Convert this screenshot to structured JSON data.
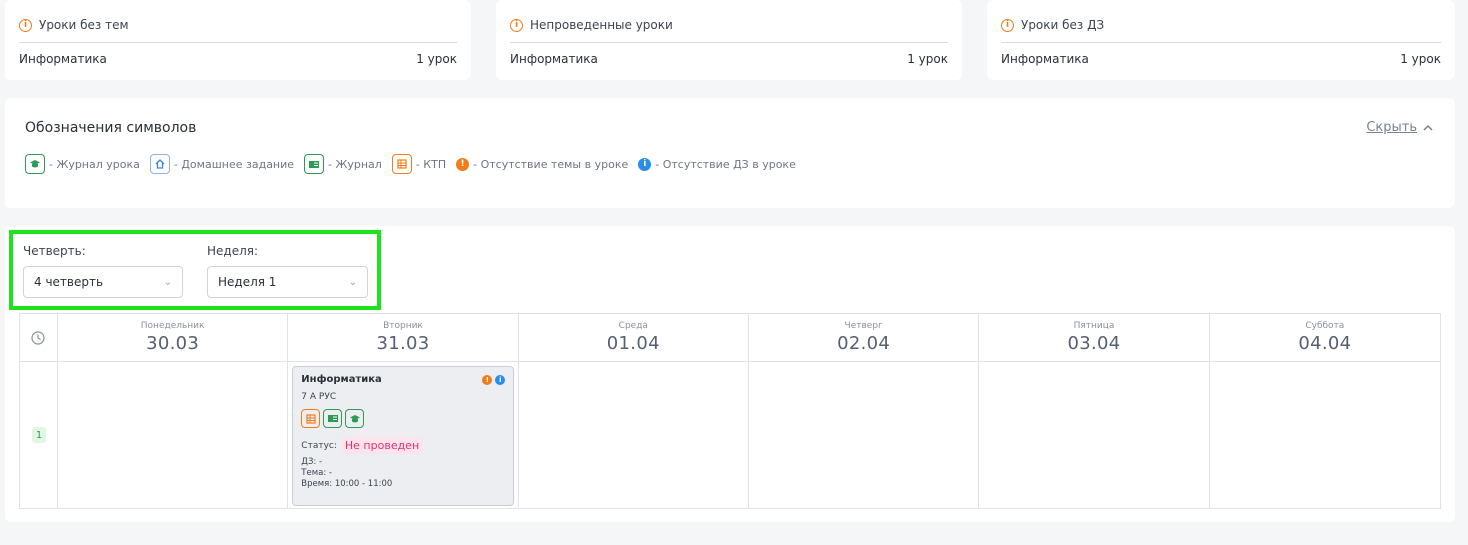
{
  "summary_cards": [
    {
      "title": "Уроки без тем",
      "subject": "Информатика",
      "count": "1 урок"
    },
    {
      "title": "Непроведенные уроки",
      "subject": "Информатика",
      "count": "1 урок"
    },
    {
      "title": "Уроки без ДЗ",
      "subject": "Информатика",
      "count": "1 урок"
    }
  ],
  "legend": {
    "title": "Обозначения символов",
    "hide_label": "Скрыть",
    "items": [
      {
        "icon": "graduation-cap-icon",
        "label": "- Журнал урока"
      },
      {
        "icon": "house-icon",
        "label": "- Домашнее задание"
      },
      {
        "icon": "journal-book-icon",
        "label": "- Журнал"
      },
      {
        "icon": "ktp-table-icon",
        "label": "- КТП"
      },
      {
        "icon": "orange-info-dot-icon",
        "label": "- Отсутствие темы в уроке"
      },
      {
        "icon": "blue-info-dot-icon",
        "label": "- Отсутствие ДЗ в уроке"
      }
    ]
  },
  "filters": {
    "quarter_label": "Четверть:",
    "quarter_value": "4 четверть",
    "week_label": "Неделя:",
    "week_value": "Неделя 1"
  },
  "schedule": {
    "days": [
      {
        "name": "Понедельник",
        "date": "30.03"
      },
      {
        "name": "Вторник",
        "date": "31.03"
      },
      {
        "name": "Среда",
        "date": "01.04"
      },
      {
        "name": "Четверг",
        "date": "02.04"
      },
      {
        "name": "Пятница",
        "date": "03.04"
      },
      {
        "name": "Суббота",
        "date": "04.04"
      }
    ],
    "lesson_number": "1",
    "lesson": {
      "subject": "Информатика",
      "class": "7 А РУС",
      "status_label": "Статус:",
      "status_value": "Не проведен",
      "homework": "ДЗ: -",
      "topic": "Тема: -",
      "time": "Время: 10:00 - 11:00"
    }
  },
  "colors": {
    "accent_orange": "#f07c1b",
    "accent_green": "#2e9b52",
    "accent_blue": "#2a8de8",
    "highlight": "#1fe21f",
    "status_pink": "#e0336b"
  }
}
